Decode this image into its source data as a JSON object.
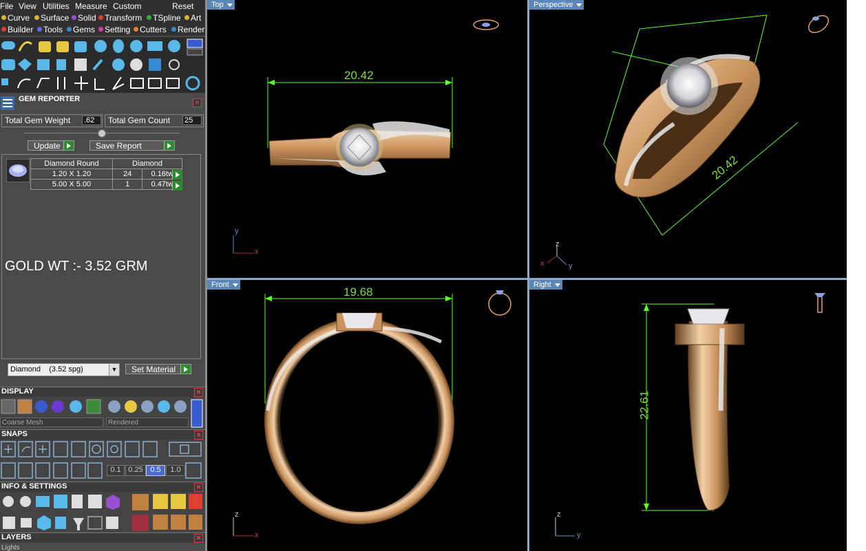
{
  "menu": [
    "File",
    "View",
    "Utilities",
    "Measure",
    "Custom",
    "Reset"
  ],
  "categories_row1": [
    {
      "label": "Curve",
      "color": "#e0b030"
    },
    {
      "label": "Surface",
      "color": "#e0b030"
    },
    {
      "label": "Solid",
      "color": "#9a4ed0"
    },
    {
      "label": "Transform",
      "color": "#e04030"
    },
    {
      "label": "TSpline",
      "color": "#3aaa3a"
    },
    {
      "label": "Art",
      "color": "#e0b030"
    }
  ],
  "categories_row2": [
    {
      "label": "Builder",
      "color": "#e04030"
    },
    {
      "label": "Tools",
      "color": "#6a6ae0"
    },
    {
      "label": "Gems",
      "color": "#3a8ad0"
    },
    {
      "label": "Setting",
      "color": "#d040a0"
    },
    {
      "label": "Cutters",
      "color": "#e08030"
    },
    {
      "label": "Render",
      "color": "#3a8ad0"
    }
  ],
  "gem_reporter": {
    "title": "GEM REPORTER",
    "total_weight_label": "Total Gem Weight",
    "total_weight_value": ".62",
    "total_count_label": "Total Gem Count",
    "total_count_value": "25",
    "update_label": "Update",
    "save_report_label": "Save Report",
    "header_shape": "Diamond Round",
    "header_material": "Diamond",
    "rows": [
      {
        "size": "1.20 X 1.20",
        "count": "24",
        "weight": "0.16tw"
      },
      {
        "size": "5.00 X 5.00",
        "count": "1",
        "weight": "0.47tw"
      }
    ],
    "note": "GOLD WT :- 3.52 GRM",
    "material_select": "Diamond    (3.52 spg)",
    "set_material_label": "Set Material"
  },
  "display": {
    "title": "DISPLAY",
    "mesh_select": "Coarse Mesh",
    "render_select": "Rendered"
  },
  "snaps": {
    "title": "SNAPS",
    "grid_values": [
      "0.1",
      "0.25",
      "0.5",
      "1.0"
    ],
    "grid_selected": "0.5"
  },
  "info_settings": {
    "title": "INFO & SETTINGS"
  },
  "layers": {
    "title": "LAYERS",
    "first_label": "Lights"
  },
  "viewports": {
    "top": {
      "label": "Top",
      "dimension": "20.42",
      "axis_a": "y",
      "axis_b": "x"
    },
    "perspective": {
      "label": "Perspective",
      "dimension": "20.42",
      "axis_a": "z",
      "axis_b": "x",
      "axis_c": "y"
    },
    "front": {
      "label": "Front",
      "dimension": "19.68",
      "axis_a": "z",
      "axis_b": "x"
    },
    "right": {
      "label": "Right",
      "dimension": "22.61",
      "axis_a": "z",
      "axis_b": "y"
    }
  },
  "colors": {
    "dimension": "#7ddc3a",
    "gold": "#c9935e",
    "viewport_tag": "#5b87b8",
    "panel_bg": "#4a4a4a"
  }
}
